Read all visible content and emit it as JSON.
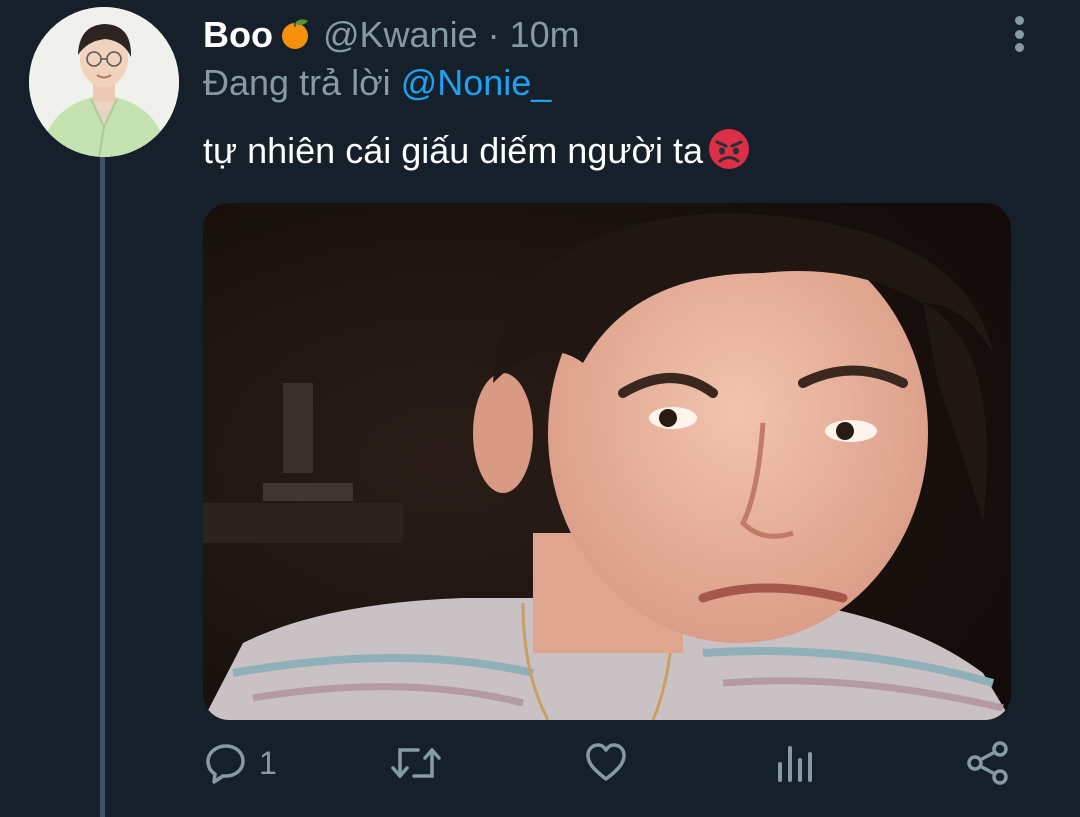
{
  "tweet": {
    "display_name": "Boo",
    "name_emoji": "tangerine-emoji",
    "handle": "@Kwanie",
    "separator": "·",
    "time": "10m",
    "reply_prefix": "Đang trả lời",
    "reply_to": "@Nonie_",
    "text": "tự nhiên cái giấu diếm người ta",
    "text_emoji": "angry-face-emoji"
  },
  "actions": {
    "reply_count": "1",
    "icons": [
      "reply-icon",
      "retweet-icon",
      "like-icon",
      "analytics-icon",
      "share-icon"
    ]
  },
  "colors": {
    "background": "#15202b",
    "secondary_text": "#8899a6",
    "mention": "#1da1f2",
    "thread_line": "#3d5466"
  }
}
